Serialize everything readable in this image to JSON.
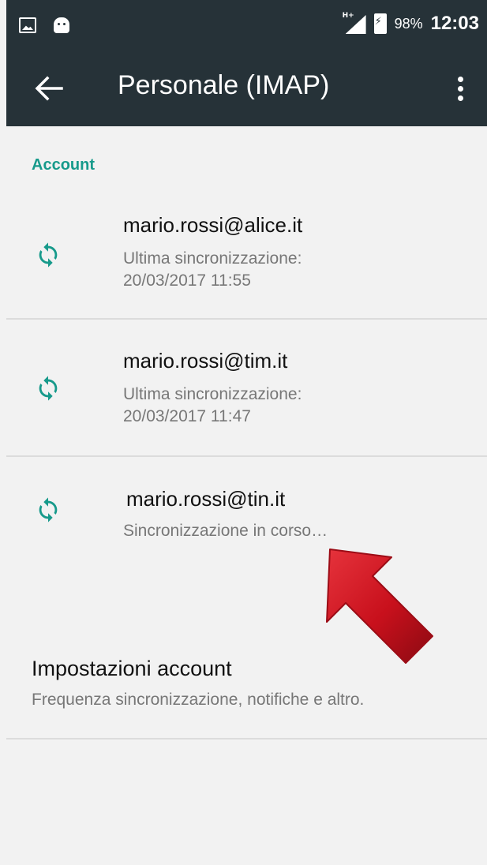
{
  "status_bar": {
    "network": "H+",
    "battery": "98%",
    "time": "12:03"
  },
  "app_bar": {
    "title": "Personale (IMAP)"
  },
  "section": {
    "header": "Account"
  },
  "accounts": [
    {
      "email": "mario.rossi@alice.it",
      "status_line1": "Ultima sincronizzazione:",
      "status_line2": "20/03/2017 11:55"
    },
    {
      "email": "mario.rossi@tim.it",
      "status_line1": "Ultima sincronizzazione:",
      "status_line2": "20/03/2017 11:47"
    },
    {
      "email": "mario.rossi@tin.it",
      "status_line1": "Sincronizzazione in corso…"
    }
  ],
  "settings": {
    "title": "Impostazioni account",
    "description": "Frequenza sincronizzazione, notifiche e altro."
  },
  "colors": {
    "app_bar": "#263238",
    "accent": "#179a8b",
    "arrow": "#c8101c"
  }
}
